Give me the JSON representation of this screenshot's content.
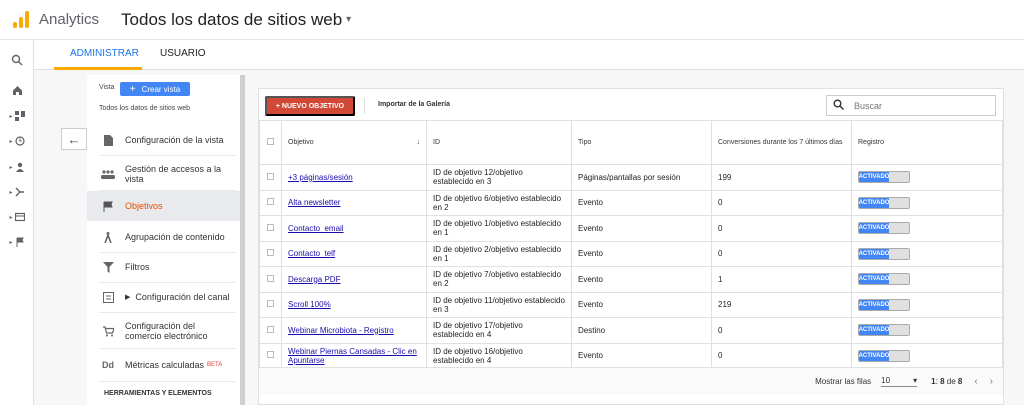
{
  "header": {
    "app_name": "Analytics",
    "property_title": "Todos los datos de sitios web"
  },
  "tabs": [
    "ADMINISTRAR",
    "USUARIO"
  ],
  "nav": {
    "vista_label": "Vista",
    "crear_vista_label": "Crear vista",
    "view_name": "Todos los datos de sitios web",
    "items": [
      {
        "label": "Configuración de la vista",
        "icon": "document-icon"
      },
      {
        "label": "Gestión de accesos a la vista",
        "icon": "people-icon"
      },
      {
        "label": "Objetivos",
        "icon": "flag-icon"
      },
      {
        "label": "Agrupación de contenido",
        "icon": "person-walk-icon"
      },
      {
        "label": "Filtros",
        "icon": "filter-icon"
      },
      {
        "label": "Configuración del canal",
        "icon": "channel-icon"
      },
      {
        "label": "Configuración del comercio electrónico",
        "icon": "cart-icon"
      },
      {
        "label": "Métricas calculadas",
        "icon": "dd-icon",
        "badge": "BETA"
      }
    ],
    "tools_label": "HERRAMIENTAS Y ELEMENTOS"
  },
  "toolbar": {
    "new_goal": "+ NUEVO OBJETIVO",
    "import": "Importar de la Galería",
    "search_placeholder": "Buscar"
  },
  "table": {
    "headers": [
      "Objetivo",
      "ID",
      "Tipo",
      "Conversiones durante los 7 últimos días",
      "Registro"
    ],
    "rows": [
      {
        "objetivo": "+3 páginas/sesión",
        "id": "ID de objetivo 12/objetivo establecido en 3",
        "tipo": "Páginas/pantallas por sesión",
        "conv": "199",
        "registro": "ACTIVADO"
      },
      {
        "objetivo": "Alta newsletter",
        "id": "ID de objetivo 6/objetivo establecido en 2",
        "tipo": "Evento",
        "conv": "0",
        "registro": "ACTIVADO"
      },
      {
        "objetivo": "Contacto_email",
        "id": "ID de objetivo 1/objetivo establecido en 1",
        "tipo": "Evento",
        "conv": "0",
        "registro": "ACTIVADO"
      },
      {
        "objetivo": "Contacto_telf",
        "id": "ID de objetivo 2/objetivo establecido en 1",
        "tipo": "Evento",
        "conv": "0",
        "registro": "ACTIVADO"
      },
      {
        "objetivo": "Descarga PDF",
        "id": "ID de objetivo 7/objetivo establecido en 2",
        "tipo": "Evento",
        "conv": "1",
        "registro": "ACTIVADO"
      },
      {
        "objetivo": "Scroll 100%",
        "id": "ID de objetivo 11/objetivo establecido en 3",
        "tipo": "Evento",
        "conv": "219",
        "registro": "ACTIVADO"
      },
      {
        "objetivo": "Webinar Microbiota - Registro",
        "id": "ID de objetivo 17/objetivo establecido en 4",
        "tipo": "Destino",
        "conv": "0",
        "registro": "ACTIVADO"
      },
      {
        "objetivo": "Webinar Piernas Cansadas - Clic en Apuntarse",
        "id": "ID de objetivo 16/objetivo establecido en 4",
        "tipo": "Evento",
        "conv": "0",
        "registro": "ACTIVADO"
      }
    ]
  },
  "pager": {
    "rows_label": "Mostrar las filas",
    "rows_value": "10",
    "range_start": "1",
    "range_end": "8",
    "range_sep": " de ",
    "total": "8"
  }
}
